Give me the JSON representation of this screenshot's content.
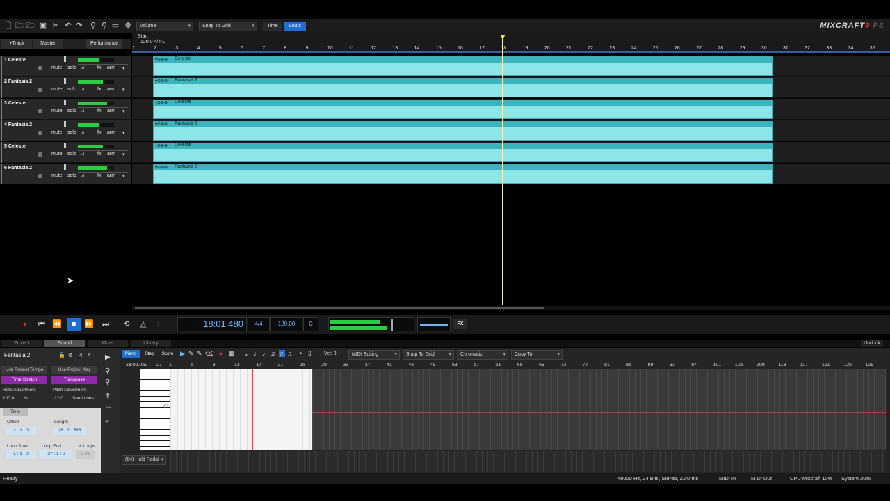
{
  "app": {
    "logo_main": "MIXCRAFT",
    "logo_accent": "9",
    "logo_suffix": "PS"
  },
  "toolbar": {
    "dropdown_volume": "Volume",
    "dropdown_snap": "Snap To Grid",
    "time_label": "Time",
    "beats_label": "Beats"
  },
  "trackbar": {
    "add_track": "+Track",
    "master": "Master",
    "performance": "Performance"
  },
  "ruler": {
    "start_label": "Start",
    "tempo_marker": "120.0 4/4 C",
    "ticks": [
      "1",
      "2",
      "3",
      "4",
      "5",
      "6",
      "7",
      "8",
      "9",
      "10",
      "11",
      "12",
      "13",
      "14",
      "15",
      "16",
      "17",
      "18",
      "19",
      "20",
      "21",
      "22",
      "23",
      "24",
      "25",
      "26",
      "27",
      "28",
      "29",
      "30",
      "31",
      "32",
      "33",
      "34",
      "35"
    ]
  },
  "tracks": [
    {
      "name": "1 Celeste",
      "clip": "Celeste"
    },
    {
      "name": "2 Fantasia 2",
      "clip": "Fantasia 2"
    },
    {
      "name": "3 Celeste",
      "clip": "Celeste"
    },
    {
      "name": "4 Fantasia 2",
      "clip": "Fantasia 2"
    },
    {
      "name": "5 Celeste",
      "clip": "Celeste"
    },
    {
      "name": "6 Fantasia 2",
      "clip": "Fantasia 2"
    }
  ],
  "track_controls": {
    "mute": "mute",
    "solo": "solo",
    "fx": "fx",
    "arm": "arm"
  },
  "transport": {
    "time": "18:01.480",
    "signature": "4/4",
    "tempo": "120.00",
    "key": "C",
    "fx": "FX"
  },
  "tabs": {
    "project": "Project",
    "sound": "Sound",
    "mixer": "Mixer",
    "library": "Library",
    "undock": "Undock"
  },
  "sound_panel": {
    "instrument": "Fantasia 2",
    "num1": "4",
    "num2": "4",
    "use_tempo": "Use Project Tempo",
    "use_key": "Use Project Key",
    "time_stretch": "Time Stretch",
    "transpose": "Transpose",
    "rate_label": "Rate Adjustment",
    "rate_value": "100.0",
    "rate_unit": "%",
    "pitch_label": "Pitch Adjustment",
    "pitch_value": "-12.0",
    "pitch_unit": "Semitones",
    "time_tab": "Time",
    "offset_label": "Offset",
    "offset_value": "2 : 1 : 0",
    "length_label": "Length",
    "length_value": "28 : 2 : 585",
    "loop_start_label": "Loop Start",
    "loop_start_value": "1 : 1 : 0",
    "loop_end_label": "Loop End",
    "loop_end_value": "27 : 1 : 0",
    "loops_label": "# Loops",
    "loops_value": "0.96"
  },
  "pianoroll": {
    "tab_piano": "Piano",
    "tab_step": "Step",
    "tab_score": "Score",
    "vel_label": "Vel: 0",
    "midi_editing": "MIDI Editing",
    "snap": "Snap To Grid",
    "scale": "Chromatic",
    "copy_to": "Copy To",
    "position": "28:02.060",
    "note": "D7",
    "ticks": [
      "1",
      "5",
      "9",
      "13",
      "17",
      "21",
      "25",
      "29",
      "33",
      "37",
      "41",
      "45",
      "49",
      "53",
      "57",
      "61",
      "65",
      "69",
      "73",
      "77",
      "81",
      "85",
      "89",
      "93",
      "97",
      "101",
      "105",
      "109",
      "113",
      "117",
      "121",
      "125",
      "129"
    ],
    "controller": "(64) Hold Pedal",
    "c_label": "C7"
  },
  "status": {
    "ready": "Ready",
    "audio": "48000 Hz, 24 Bits, Stereo, 20.0 ms",
    "midi_in": "MIDI In",
    "midi_out": "MIDI Out",
    "cpu": "CPU Mixcraft 10%",
    "system": "System 20%"
  }
}
